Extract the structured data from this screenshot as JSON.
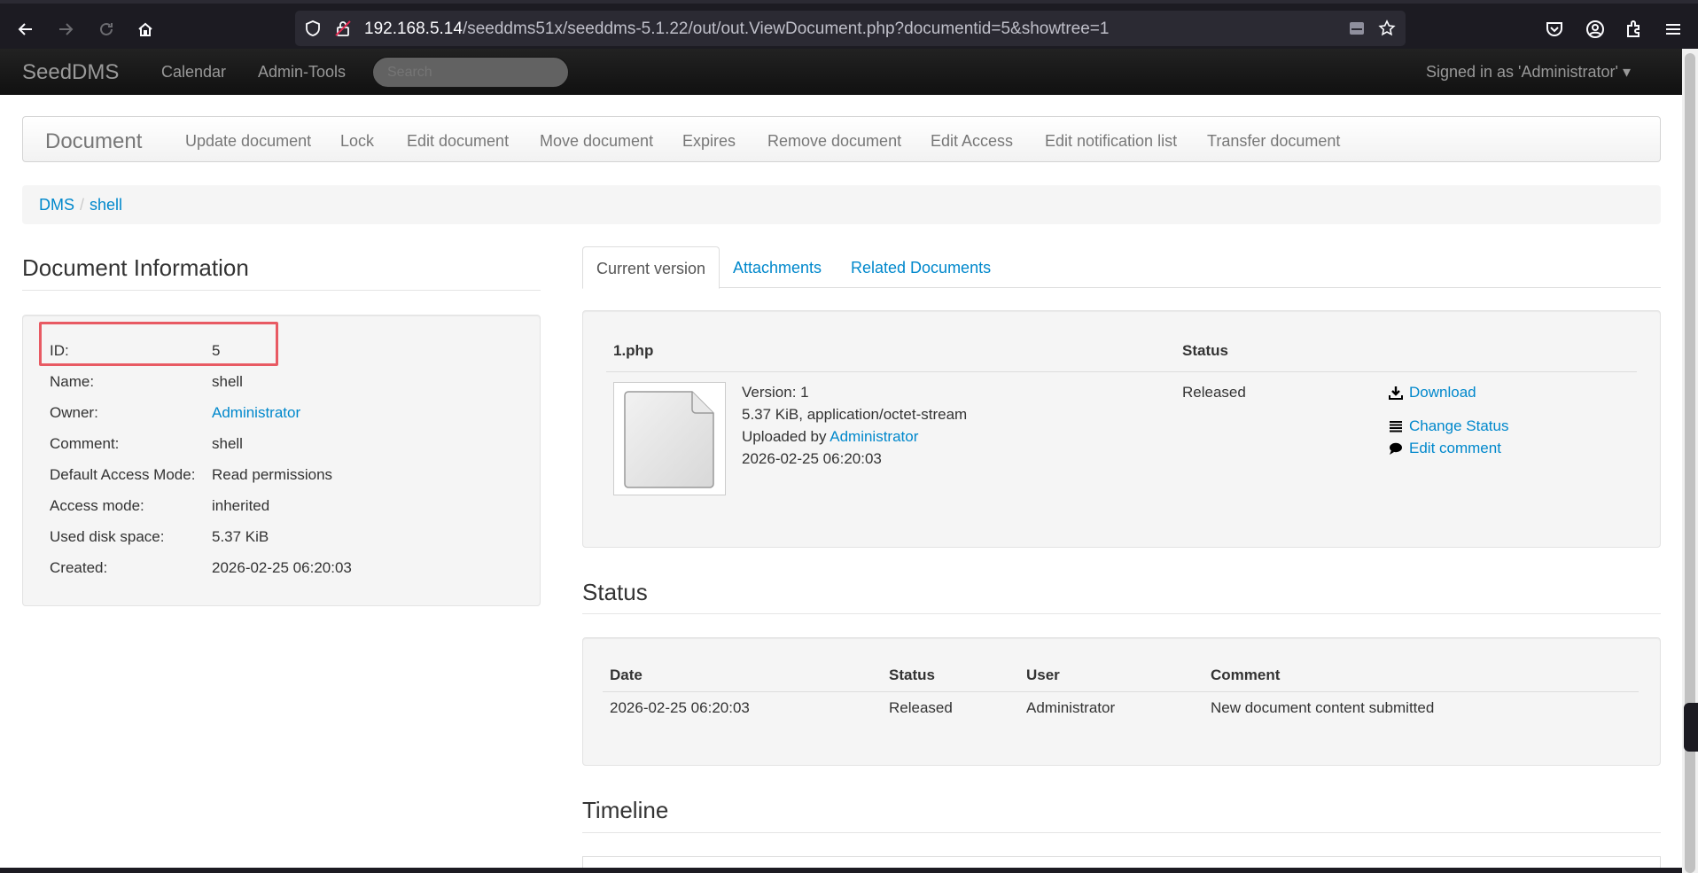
{
  "browser": {
    "url_host": "192.168.5.14",
    "url_path": "/seeddms51x/seeddms-5.1.22/out/out.ViewDocument.php?documentid=5&showtree=1"
  },
  "navbar": {
    "brand": "SeedDMS",
    "links": [
      "Calendar",
      "Admin-Tools"
    ],
    "search_placeholder": "Search",
    "signed_in": "Signed in as 'Administrator'"
  },
  "subnav": {
    "brand": "Document",
    "links": [
      "Update document",
      "Lock",
      "Edit document",
      "Move document",
      "Expires",
      "Remove document",
      "Edit Access",
      "Edit notification list",
      "Transfer document"
    ]
  },
  "breadcrumb": [
    "DMS",
    "shell"
  ],
  "doc_info": {
    "title": "Document Information",
    "rows": [
      {
        "label": "ID:",
        "value": "5"
      },
      {
        "label": "Name:",
        "value": "shell"
      },
      {
        "label": "Owner:",
        "value": "Administrator"
      },
      {
        "label": "Comment:",
        "value": "shell"
      },
      {
        "label": "Default Access Mode:",
        "value": "Read permissions"
      },
      {
        "label": "Access mode:",
        "value": "inherited"
      },
      {
        "label": "Used disk space:",
        "value": "5.37 KiB"
      },
      {
        "label": "Created:",
        "value": "2026-02-25 06:20:03"
      }
    ]
  },
  "tabs": [
    "Current version",
    "Attachments",
    "Related Documents"
  ],
  "current_version": {
    "file_header": "1.php",
    "status_header": "Status",
    "version": "Version: 1",
    "size_type": "5.37 KiB, application/octet-stream",
    "uploaded_by_prefix": "Uploaded by ",
    "uploaded_by": "Administrator",
    "date": "2026-02-25 06:20:03",
    "status": "Released",
    "actions": [
      "Download",
      "Change Status",
      "Edit comment"
    ]
  },
  "status_section": {
    "title": "Status",
    "headers": [
      "Date",
      "Status",
      "User",
      "Comment"
    ],
    "rows": [
      [
        "2026-02-25 06:20:03",
        "Released",
        "Administrator",
        "New document content submitted"
      ]
    ]
  },
  "timeline": {
    "title": "Timeline"
  }
}
